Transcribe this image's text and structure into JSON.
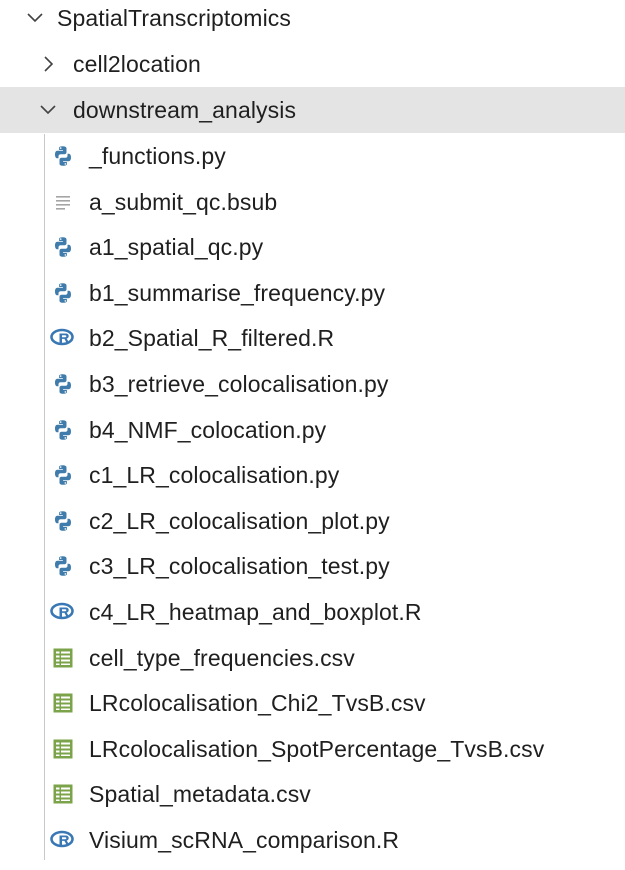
{
  "explorer": {
    "root": {
      "label": "SpatialTranscriptomics",
      "expanded": true
    },
    "folders": [
      {
        "label": "cell2location",
        "expanded": false
      },
      {
        "label": "downstream_analysis",
        "expanded": true
      }
    ],
    "files": [
      {
        "label": "_functions.py",
        "icon": "python-icon"
      },
      {
        "label": "a_submit_qc.bsub",
        "icon": "text-file-icon"
      },
      {
        "label": "a1_spatial_qc.py",
        "icon": "python-icon"
      },
      {
        "label": "b1_summarise_frequency.py",
        "icon": "python-icon"
      },
      {
        "label": "b2_Spatial_R_filtered.R",
        "icon": "r-icon"
      },
      {
        "label": "b3_retrieve_colocalisation.py",
        "icon": "python-icon"
      },
      {
        "label": "b4_NMF_colocation.py",
        "icon": "python-icon"
      },
      {
        "label": "c1_LR_colocalisation.py",
        "icon": "python-icon"
      },
      {
        "label": "c2_LR_colocalisation_plot.py",
        "icon": "python-icon"
      },
      {
        "label": "c3_LR_colocalisation_test.py",
        "icon": "python-icon"
      },
      {
        "label": "c4_LR_heatmap_and_boxplot.R",
        "icon": "r-icon"
      },
      {
        "label": "cell_type_frequencies.csv",
        "icon": "csv-icon"
      },
      {
        "label": "LRcolocalisation_Chi2_TvsB.csv",
        "icon": "csv-icon"
      },
      {
        "label": "LRcolocalisation_SpotPercentage_TvsB.csv",
        "icon": "csv-icon"
      },
      {
        "label": "Spatial_metadata.csv",
        "icon": "csv-icon"
      },
      {
        "label": "Visium_scRNA_comparison.R",
        "icon": "r-icon"
      }
    ],
    "colors": {
      "python": "#3f7cab",
      "r": "#3a78b5",
      "csv": "#7ba34a",
      "text": "#a5a5a5",
      "selected_bg": "#e4e4e4"
    }
  }
}
